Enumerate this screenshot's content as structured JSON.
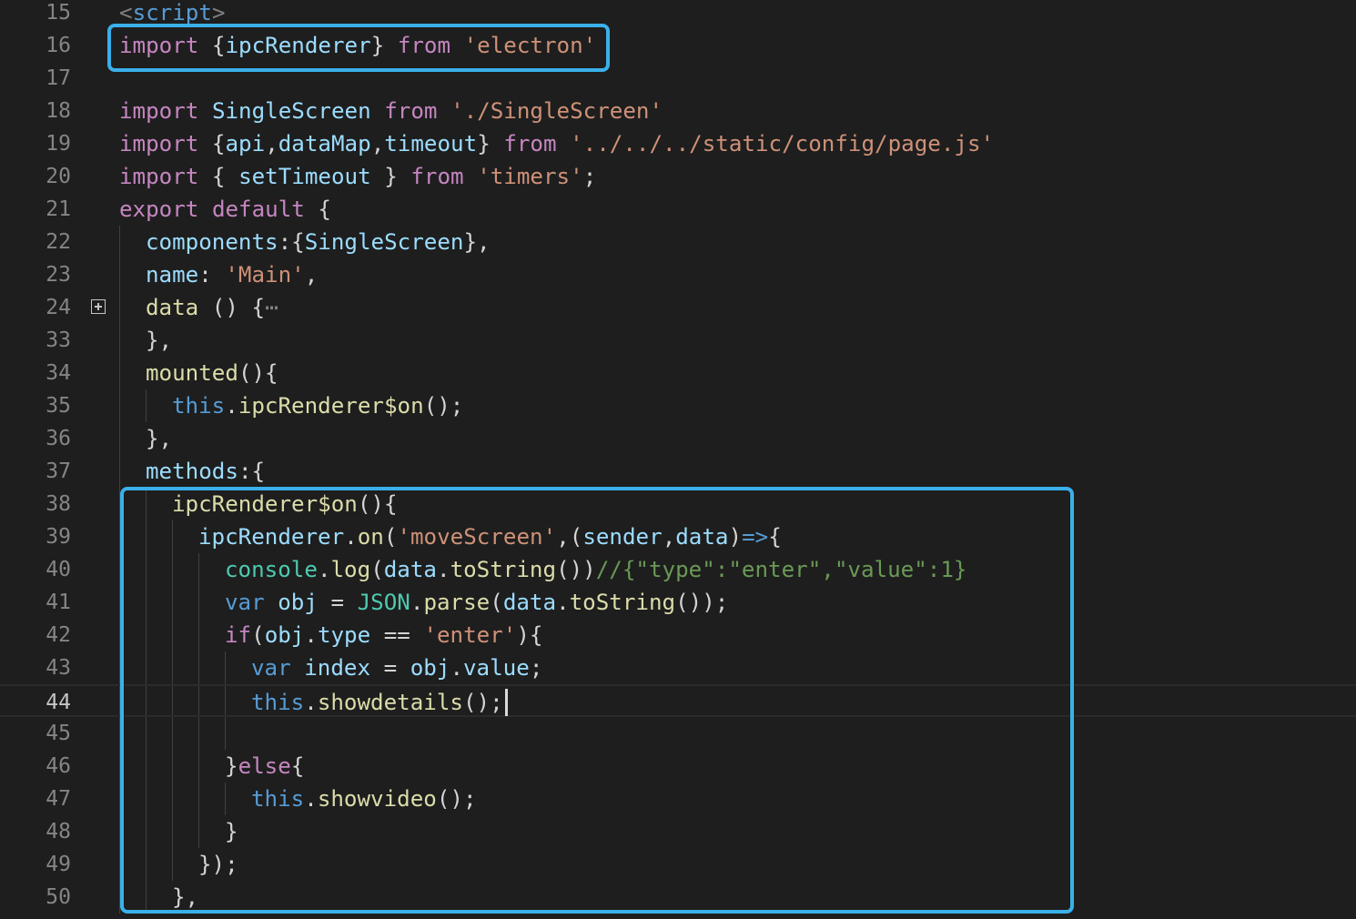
{
  "editor": {
    "active_line": "44",
    "colors": {
      "background": "#1e1e1e",
      "highlight_box": "#3ab0ea",
      "keyword_pink": "#c586c0",
      "keyword_blue": "#569cd6",
      "string": "#ce9178",
      "variable": "#9cdcfe",
      "function": "#dcdcaa",
      "type": "#4ec9b0",
      "comment": "#6a9955",
      "plain": "#d4d4d4",
      "line_number": "#858585"
    },
    "fold_icon": "plus-square-icon",
    "lines": [
      {
        "num": "15",
        "indent": 0,
        "tokens": [
          [
            "<",
            "gray"
          ],
          [
            "script",
            "blue"
          ],
          [
            ">",
            "gray"
          ]
        ]
      },
      {
        "num": "16",
        "indent": 0,
        "tokens": [
          [
            "import",
            "pink"
          ],
          [
            " {",
            "plain"
          ],
          [
            "ipcRenderer",
            "var"
          ],
          [
            "} ",
            "plain"
          ],
          [
            "from",
            "pink"
          ],
          [
            " ",
            "plain"
          ],
          [
            "'electron'",
            "str"
          ]
        ]
      },
      {
        "num": "17",
        "indent": 0,
        "tokens": []
      },
      {
        "num": "18",
        "indent": 0,
        "tokens": [
          [
            "import",
            "pink"
          ],
          [
            " ",
            "plain"
          ],
          [
            "SingleScreen",
            "var"
          ],
          [
            " ",
            "plain"
          ],
          [
            "from",
            "pink"
          ],
          [
            " ",
            "plain"
          ],
          [
            "'./SingleScreen'",
            "str"
          ]
        ]
      },
      {
        "num": "19",
        "indent": 0,
        "tokens": [
          [
            "import",
            "pink"
          ],
          [
            " {",
            "plain"
          ],
          [
            "api",
            "var"
          ],
          [
            ",",
            "plain"
          ],
          [
            "dataMap",
            "var"
          ],
          [
            ",",
            "plain"
          ],
          [
            "timeout",
            "var"
          ],
          [
            "} ",
            "plain"
          ],
          [
            "from",
            "pink"
          ],
          [
            " ",
            "plain"
          ],
          [
            "'../../../static/config/page.js'",
            "str"
          ]
        ]
      },
      {
        "num": "20",
        "indent": 0,
        "tokens": [
          [
            "import",
            "pink"
          ],
          [
            " { ",
            "plain"
          ],
          [
            "setTimeout",
            "var"
          ],
          [
            " } ",
            "plain"
          ],
          [
            "from",
            "pink"
          ],
          [
            " ",
            "plain"
          ],
          [
            "'timers'",
            "str"
          ],
          [
            ";",
            "plain"
          ]
        ]
      },
      {
        "num": "21",
        "indent": 0,
        "tokens": [
          [
            "export",
            "pink"
          ],
          [
            " ",
            "plain"
          ],
          [
            "default",
            "pink"
          ],
          [
            " {",
            "plain"
          ]
        ]
      },
      {
        "num": "22",
        "indent": 1,
        "tokens": [
          [
            "components",
            "var"
          ],
          [
            ":{",
            "plain"
          ],
          [
            "SingleScreen",
            "var"
          ],
          [
            "},",
            "plain"
          ]
        ]
      },
      {
        "num": "23",
        "indent": 1,
        "tokens": [
          [
            "name",
            "var"
          ],
          [
            ": ",
            "plain"
          ],
          [
            "'Main'",
            "str"
          ],
          [
            ",",
            "plain"
          ]
        ]
      },
      {
        "num": "24",
        "indent": 1,
        "fold": true,
        "tokens": [
          [
            "data",
            "fn"
          ],
          [
            " () {",
            "plain"
          ],
          [
            "⋯",
            "gray"
          ]
        ]
      },
      {
        "num": "33",
        "indent": 1,
        "tokens": [
          [
            "},",
            "plain"
          ]
        ]
      },
      {
        "num": "34",
        "indent": 1,
        "tokens": [
          [
            "mounted",
            "fn"
          ],
          [
            "(){",
            "plain"
          ]
        ]
      },
      {
        "num": "35",
        "indent": 2,
        "tokens": [
          [
            "this",
            "blue"
          ],
          [
            ".",
            "plain"
          ],
          [
            "ipcRenderer$on",
            "fn"
          ],
          [
            "();",
            "plain"
          ]
        ]
      },
      {
        "num": "36",
        "indent": 1,
        "tokens": [
          [
            "},",
            "plain"
          ]
        ]
      },
      {
        "num": "37",
        "indent": 1,
        "tokens": [
          [
            "methods",
            "var"
          ],
          [
            ":{",
            "plain"
          ]
        ]
      },
      {
        "num": "38",
        "indent": 2,
        "tokens": [
          [
            "ipcRenderer$on",
            "fn"
          ],
          [
            "(){",
            "plain"
          ]
        ]
      },
      {
        "num": "39",
        "indent": 3,
        "tokens": [
          [
            "ipcRenderer",
            "var"
          ],
          [
            ".",
            "plain"
          ],
          [
            "on",
            "fn"
          ],
          [
            "(",
            "plain"
          ],
          [
            "'moveScreen'",
            "str"
          ],
          [
            ",(",
            "plain"
          ],
          [
            "sender",
            "var"
          ],
          [
            ",",
            "plain"
          ],
          [
            "data",
            "var"
          ],
          [
            ")",
            "plain"
          ],
          [
            "=>",
            "blue"
          ],
          [
            "{",
            "plain"
          ]
        ]
      },
      {
        "num": "40",
        "indent": 4,
        "tokens": [
          [
            "console",
            "type"
          ],
          [
            ".",
            "plain"
          ],
          [
            "log",
            "fn"
          ],
          [
            "(",
            "plain"
          ],
          [
            "data",
            "var"
          ],
          [
            ".",
            "plain"
          ],
          [
            "toString",
            "fn"
          ],
          [
            "())",
            "plain"
          ],
          [
            "//{\"type\":\"enter\",\"value\":1}",
            "comment"
          ]
        ]
      },
      {
        "num": "41",
        "indent": 4,
        "tokens": [
          [
            "var",
            "blue"
          ],
          [
            " ",
            "plain"
          ],
          [
            "obj",
            "var"
          ],
          [
            " = ",
            "plain"
          ],
          [
            "JSON",
            "type"
          ],
          [
            ".",
            "plain"
          ],
          [
            "parse",
            "fn"
          ],
          [
            "(",
            "plain"
          ],
          [
            "data",
            "var"
          ],
          [
            ".",
            "plain"
          ],
          [
            "toString",
            "fn"
          ],
          [
            "());",
            "plain"
          ]
        ]
      },
      {
        "num": "42",
        "indent": 4,
        "tokens": [
          [
            "if",
            "pink"
          ],
          [
            "(",
            "plain"
          ],
          [
            "obj",
            "var"
          ],
          [
            ".",
            "plain"
          ],
          [
            "type",
            "var"
          ],
          [
            " == ",
            "plain"
          ],
          [
            "'enter'",
            "str"
          ],
          [
            "){",
            "plain"
          ]
        ]
      },
      {
        "num": "43",
        "indent": 5,
        "tokens": [
          [
            "var",
            "blue"
          ],
          [
            " ",
            "plain"
          ],
          [
            "index",
            "var"
          ],
          [
            " = ",
            "plain"
          ],
          [
            "obj",
            "var"
          ],
          [
            ".",
            "plain"
          ],
          [
            "value",
            "var"
          ],
          [
            ";",
            "plain"
          ]
        ]
      },
      {
        "num": "44",
        "indent": 5,
        "cursor": true,
        "tokens": [
          [
            "this",
            "blue"
          ],
          [
            ".",
            "plain"
          ],
          [
            "showdetails",
            "fn"
          ],
          [
            "();",
            "plain"
          ]
        ]
      },
      {
        "num": "45",
        "indent": 5,
        "tokens": []
      },
      {
        "num": "46",
        "indent": 4,
        "tokens": [
          [
            "}",
            "plain"
          ],
          [
            "else",
            "pink"
          ],
          [
            "{",
            "plain"
          ]
        ]
      },
      {
        "num": "47",
        "indent": 5,
        "tokens": [
          [
            "this",
            "blue"
          ],
          [
            ".",
            "plain"
          ],
          [
            "showvideo",
            "fn"
          ],
          [
            "();",
            "plain"
          ]
        ]
      },
      {
        "num": "48",
        "indent": 4,
        "tokens": [
          [
            "}",
            "plain"
          ]
        ]
      },
      {
        "num": "49",
        "indent": 3,
        "tokens": [
          [
            "});",
            "plain"
          ]
        ]
      },
      {
        "num": "50",
        "indent": 2,
        "tokens": [
          [
            "},",
            "plain"
          ]
        ]
      }
    ]
  }
}
